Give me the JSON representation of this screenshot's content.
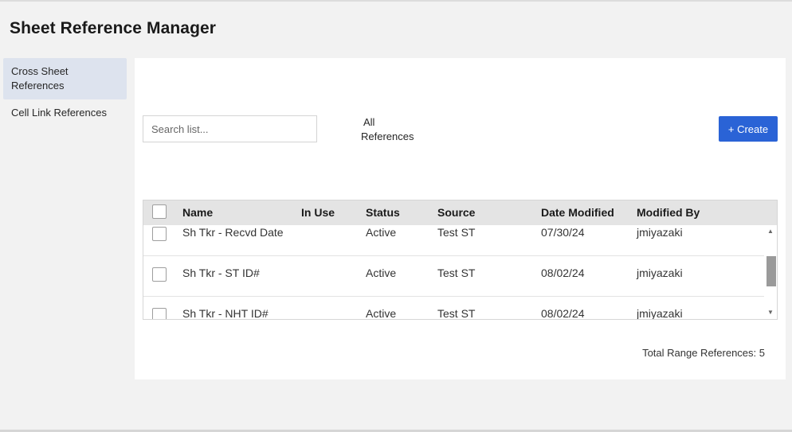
{
  "page": {
    "title": "Sheet Reference Manager"
  },
  "sidebar": {
    "items": [
      {
        "label": "Cross Sheet References",
        "active": true
      },
      {
        "label": "Cell Link References",
        "active": false
      }
    ]
  },
  "toolbar": {
    "search_placeholder": "Search list...",
    "filter_line1": "All",
    "filter_line2": "References",
    "create_label": "+ Create"
  },
  "table": {
    "columns": [
      "Name",
      "In Use",
      "Status",
      "Source",
      "Date Modified",
      "Modified By"
    ],
    "rows": [
      {
        "name": "Sh Tkr - Recvd Date",
        "in_use": "",
        "status": "Active",
        "source": "Test ST",
        "date": "07/30/24",
        "by": "jmiyazaki"
      },
      {
        "name": "Sh Tkr - ST ID#",
        "in_use": "",
        "status": "Active",
        "source": "Test ST",
        "date": "08/02/24",
        "by": "jmiyazaki"
      },
      {
        "name": "Sh Tkr - NHT ID#",
        "in_use": "",
        "status": "Active",
        "source": "Test ST",
        "date": "08/02/24",
        "by": "jmiyazaki"
      }
    ]
  },
  "footer": {
    "total": "Total Range References: 5"
  },
  "colors": {
    "accent": "#2a63d6",
    "active_nav": "#dde3ee",
    "header_bg": "#e4e4e4"
  }
}
